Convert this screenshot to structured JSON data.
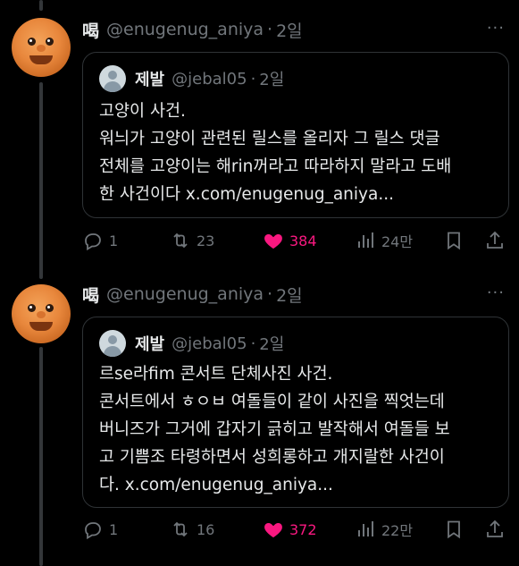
{
  "posts": [
    {
      "author_name": "喝",
      "author_handle": "@enugenug_aniya",
      "separator": "·",
      "time": "2일",
      "more": "···",
      "quote": {
        "author_name": "제발",
        "author_handle": "@jebal05",
        "separator": "·",
        "time": "2일",
        "lines": [
          "고양이 사건.",
          "워늬가 고양이 관련된 릴스를 올리자 그 릴스 댓글",
          "전체를 고양이는 해rin꺼라고 따라하지 말라고 도배",
          "한 사건이다 x.com/enugenug_aniya..."
        ]
      },
      "stats": {
        "replies": "1",
        "reposts": "23",
        "likes": "384",
        "views": "24만"
      }
    },
    {
      "author_name": "喝",
      "author_handle": "@enugenug_aniya",
      "separator": "·",
      "time": "2일",
      "more": "···",
      "quote": {
        "author_name": "제발",
        "author_handle": "@jebal05",
        "separator": "·",
        "time": "2일",
        "lines": [
          "르se라fim 콘서트 단체사진 사건.",
          "콘서트에서 ㅎㅇㅂ 여돌들이 같이 사진을 찍엇는데",
          "버니즈가 그거에 갑자기 긁히고 발작해서 여돌들 보",
          "고 기쁨조 타령하면서 성희롱하고 개지랄한 사건이",
          "다. x.com/enugenug_aniya..."
        ]
      },
      "stats": {
        "replies": "1",
        "reposts": "16",
        "likes": "372",
        "views": "22만"
      }
    }
  ],
  "colors": {
    "background": "#000000",
    "text": "#e7e9ea",
    "muted": "#71767b",
    "border": "#2f3336",
    "like": "#f91880"
  },
  "icons": [
    "reply-icon",
    "repost-icon",
    "heart-icon",
    "views-icon",
    "bookmark-icon",
    "share-icon"
  ]
}
